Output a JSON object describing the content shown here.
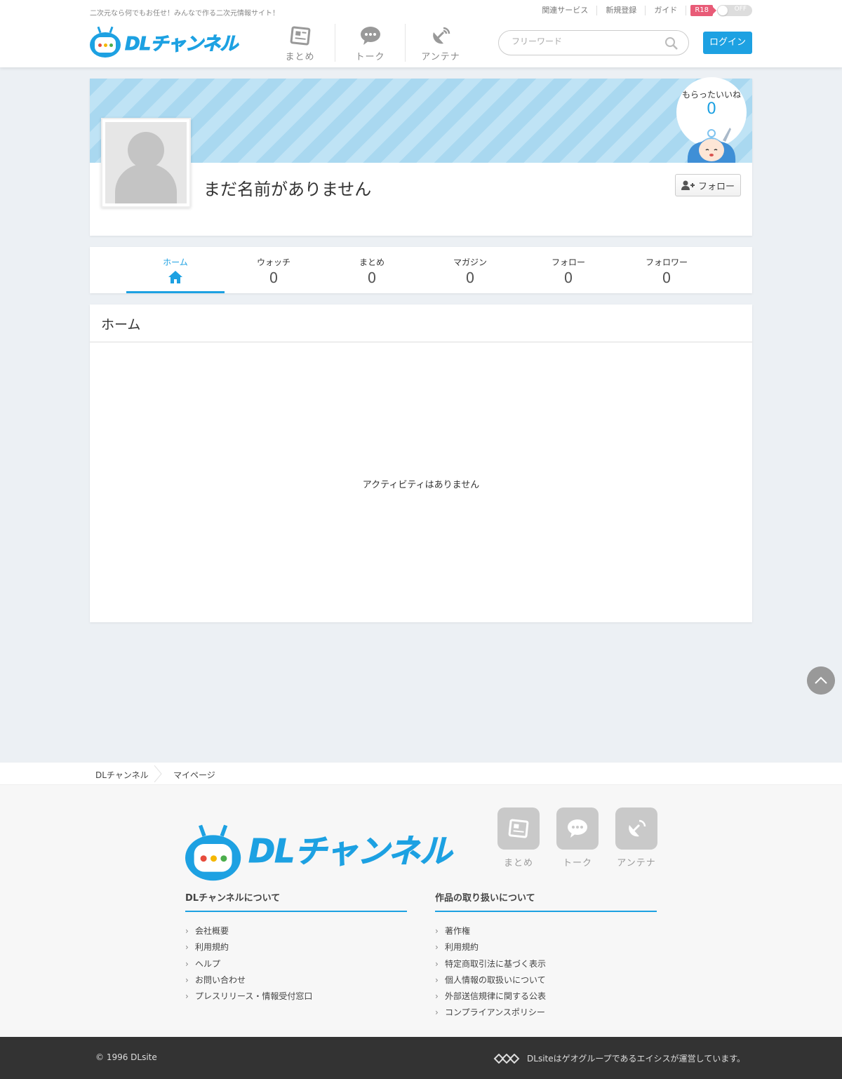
{
  "header": {
    "tagline": "二次元なら何でもお任せ！みんなで作る二次元情報サイト！",
    "util_links": [
      "関連サービス",
      "新規登録",
      "ガイド"
    ],
    "r18_badge": "R18",
    "r18_toggle": "OFF",
    "logo_text": "DLチャンネル",
    "nav": [
      {
        "label": "まとめ",
        "icon": "newspaper-icon"
      },
      {
        "label": "トーク",
        "icon": "speech-bubble-icon"
      },
      {
        "label": "アンテナ",
        "icon": "satellite-dish-icon"
      }
    ],
    "search_placeholder": "フリーワード",
    "login_label": "ログイン",
    "colors": {
      "accent": "#1da1e2",
      "r18": "#e85b77"
    }
  },
  "profile": {
    "name": "まだ名前がありません",
    "likes_label": "もらったいいね",
    "likes_count": "0",
    "follow_label": "フォロー"
  },
  "tabs": [
    {
      "label": "ホーム",
      "count": null,
      "active": true
    },
    {
      "label": "ウォッチ",
      "count": "0"
    },
    {
      "label": "まとめ",
      "count": "0"
    },
    {
      "label": "マガジン",
      "count": "0"
    },
    {
      "label": "フォロー",
      "count": "0"
    },
    {
      "label": "フォロワー",
      "count": "0"
    }
  ],
  "home": {
    "heading": "ホーム",
    "empty_message": "アクティビティはありません"
  },
  "breadcrumb": [
    "DLチャンネル",
    "マイページ"
  ],
  "footer": {
    "logo_text": "DLチャンネル",
    "nav": [
      "まとめ",
      "トーク",
      "アンテナ"
    ],
    "col1": {
      "title": "DLチャンネルについて",
      "items": [
        "会社概要",
        "利用規約",
        "ヘルプ",
        "お問い合わせ",
        "プレスリリース・情報受付窓口"
      ]
    },
    "col2": {
      "title": "作品の取り扱いについて",
      "items": [
        "著作権",
        "利用規約",
        "特定商取引法に基づく表示",
        "個人情報の取扱いについて",
        "外部送信規律に関する公表",
        "コンプライアンスポリシー"
      ]
    },
    "copyright": "© 1996 DLsite",
    "operator": "DLsiteはゲオグループであるエイシスが運営しています。"
  }
}
